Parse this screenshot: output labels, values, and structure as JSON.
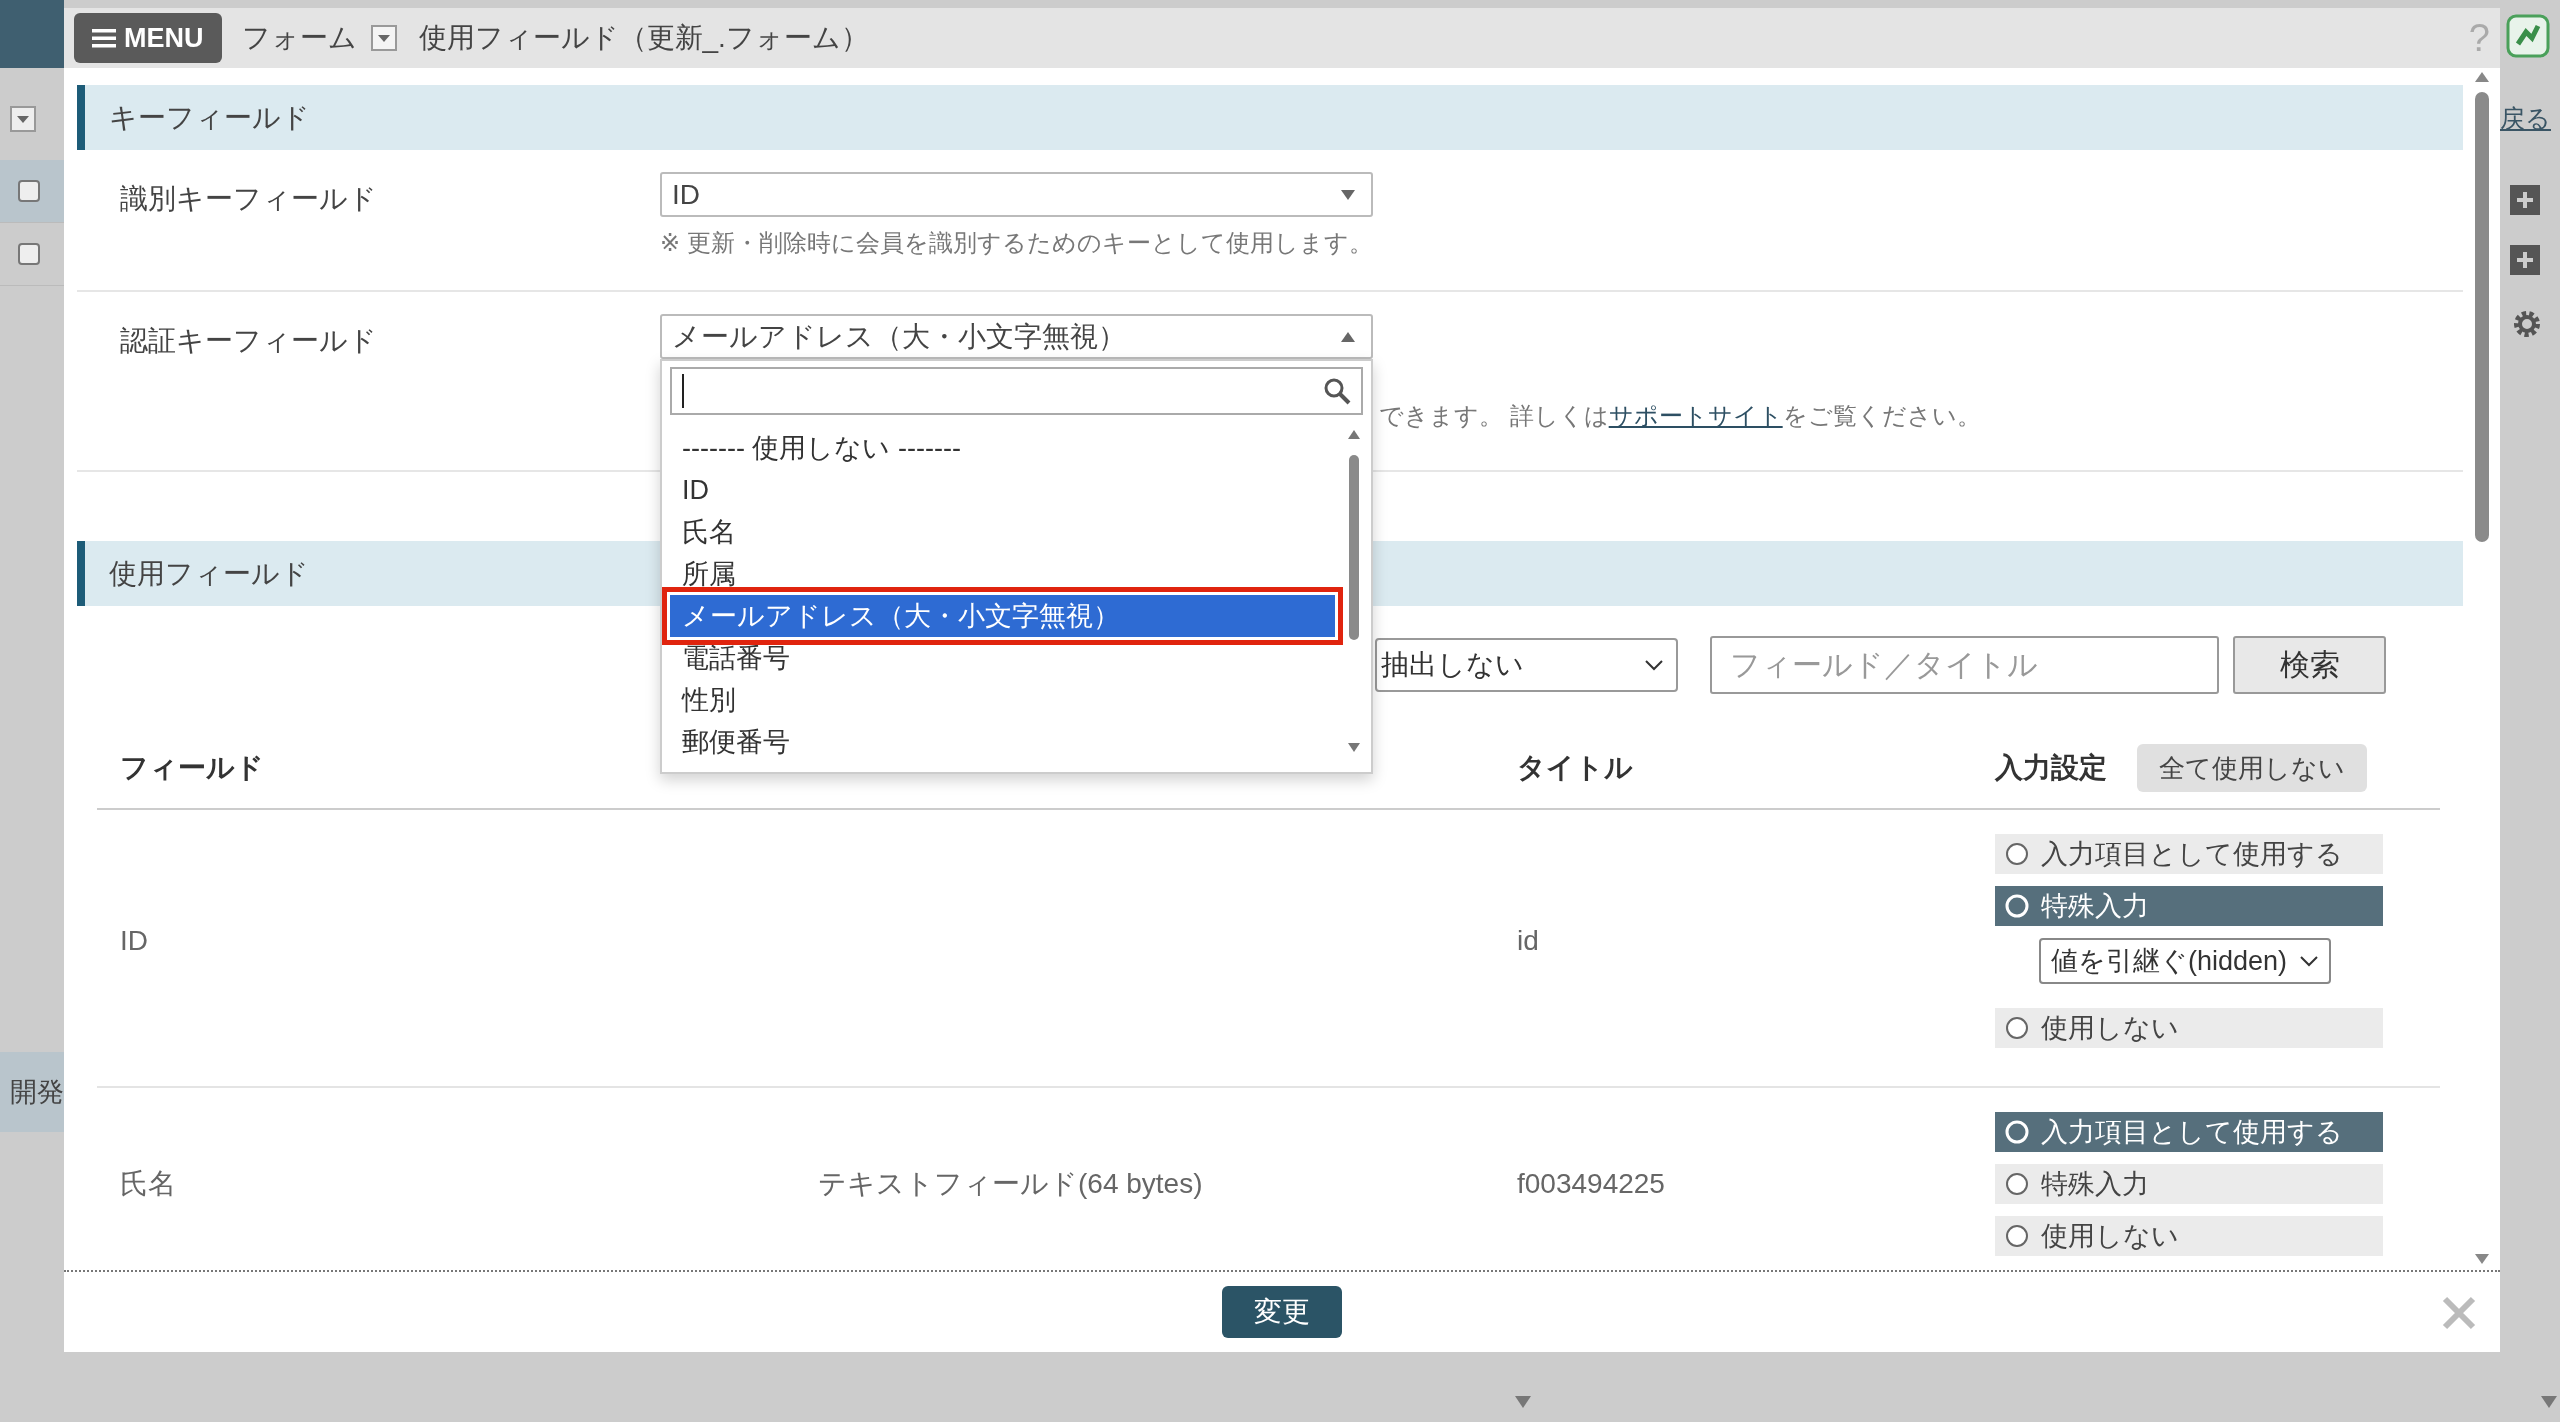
{
  "backdrop": {
    "checkboxes": [
      {
        "checked": false
      },
      {
        "checked": false
      }
    ],
    "side_tab": "開発",
    "back_link": "戻る"
  },
  "window": {
    "menu_button": "MENU",
    "breadcrumb": "フォーム",
    "title": "使用フィールド（更新_.フォーム）",
    "help": "?"
  },
  "key_section": {
    "heading": "キーフィールド",
    "identify": {
      "label": "識別キーフィールド",
      "value": "ID",
      "expanded": false,
      "note": "※ 更新・削除時に会員を識別するためのキーとして使用します。"
    },
    "auth": {
      "label": "認証キーフィールド",
      "value": "メールアドレス（大・小文字無視）",
      "expanded": true,
      "note_before": "できます。 詳しくは",
      "note_link": "サポートサイト",
      "note_after": "をご覧ください。"
    }
  },
  "dropdown": {
    "options": [
      {
        "label": "------- 使用しない -------",
        "selected": false,
        "outlined": false
      },
      {
        "label": "ID",
        "selected": false,
        "outlined": false
      },
      {
        "label": "氏名",
        "selected": false,
        "outlined": false
      },
      {
        "label": "所属",
        "selected": false,
        "outlined": false
      },
      {
        "label": "メールアドレス（大・小文字無視）",
        "selected": true,
        "outlined": true
      },
      {
        "label": "電話番号",
        "selected": false,
        "outlined": false
      },
      {
        "label": "性別",
        "selected": false,
        "outlined": false
      },
      {
        "label": "郵便番号",
        "selected": false,
        "outlined": false
      }
    ]
  },
  "fields_section": {
    "heading": "使用フィールド",
    "filter": "抽出しない",
    "search": {
      "placeholder": "フィールド／タイトル"
    },
    "search_button": "検索",
    "columns": {
      "field": "フィールド",
      "title": "タイトル",
      "settings": "入力設定"
    },
    "all_off_button": "全て使用しない",
    "rows": [
      {
        "field": "ID",
        "title": "id",
        "options": [
          {
            "label": "入力項目として使用する",
            "selected": false
          },
          {
            "label": "特殊入力",
            "selected": true,
            "sub_select": "値を引継ぐ(hidden)"
          },
          {
            "label": "使用しない",
            "selected": false
          }
        ]
      },
      {
        "field": "氏名",
        "type": "テキストフィールド(64 bytes)",
        "title": "f003494225",
        "options": [
          {
            "label": "入力項目として使用する",
            "selected": true
          },
          {
            "label": "特殊入力",
            "selected": false
          },
          {
            "label": "使用しない",
            "selected": false
          }
        ]
      }
    ]
  },
  "footer": {
    "save_button": "変更"
  }
}
